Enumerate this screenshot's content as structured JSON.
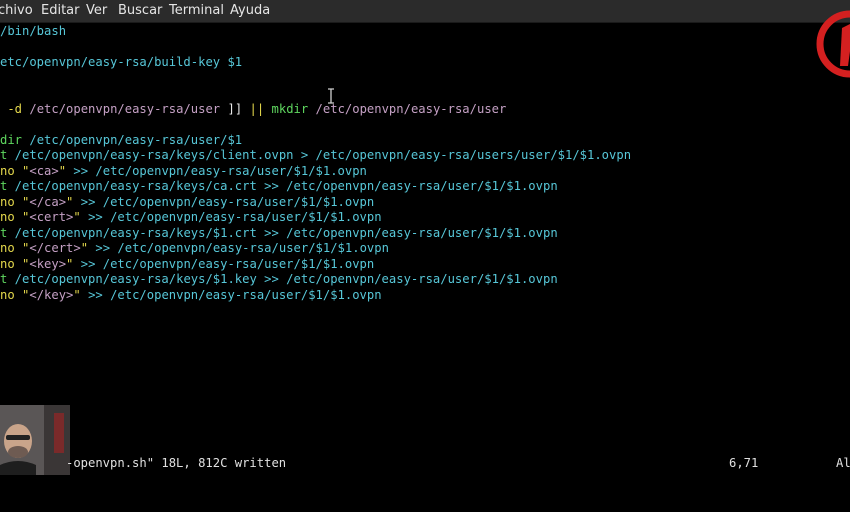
{
  "menu": {
    "items": [
      {
        "label": "chivo"
      },
      {
        "label": "Editar"
      },
      {
        "label": "Ver"
      },
      {
        "label": "Buscar"
      },
      {
        "label": "Terminal"
      },
      {
        "label": "Ayuda"
      }
    ]
  },
  "editor": {
    "lines": [
      {
        "text": "/bin/bash",
        "color": "cyan"
      },
      {
        "text": "",
        "color": "white"
      },
      {
        "text": "etc/openvpn/easy-rsa/build-key $1",
        "color": "cyan"
      },
      {
        "text": "",
        "color": "white"
      },
      {
        "text": "",
        "color": "white"
      },
      {
        "text": " -d /etc/openvpn/easy-rsa/user ]] || mkdir /etc/openvpn/easy-rsa/user",
        "color": "mixed-test"
      },
      {
        "text": "",
        "color": "white"
      },
      {
        "text": "dir /etc/openvpn/easy-rsa/user/$1",
        "color": "mixed-mkdir"
      },
      {
        "text": "t /etc/openvpn/easy-rsa/keys/client.ovpn > /etc/openvpn/easy-rsa/users/user/$1/$1.ovpn",
        "color": "mixed-cat"
      },
      {
        "text": "no \"<ca>\" >> /etc/openvpn/easy-rsa/user/$1/$1.ovpn",
        "color": "mixed-echo"
      },
      {
        "text": "t /etc/openvpn/easy-rsa/keys/ca.crt >> /etc/openvpn/easy-rsa/user/$1/$1.ovpn",
        "color": "mixed-cat"
      },
      {
        "text": "no \"</ca>\" >> /etc/openvpn/easy-rsa/user/$1/$1.ovpn",
        "color": "mixed-echo"
      },
      {
        "text": "no \"<cert>\" >> /etc/openvpn/easy-rsa/user/$1/$1.ovpn",
        "color": "mixed-echo"
      },
      {
        "text": "t /etc/openvpn/easy-rsa/keys/$1.crt >> /etc/openvpn/easy-rsa/user/$1/$1.ovpn",
        "color": "mixed-cat"
      },
      {
        "text": "no \"</cert>\" >> /etc/openvpn/easy-rsa/user/$1/$1.ovpn",
        "color": "mixed-echo"
      },
      {
        "text": "no \"<key>\" >> /etc/openvpn/easy-rsa/user/$1/$1.ovpn",
        "color": "mixed-echo"
      },
      {
        "text": "t /etc/openvpn/easy-rsa/keys/$1.key >> /etc/openvpn/easy-rsa/user/$1/$1.ovpn",
        "color": "mixed-cat"
      },
      {
        "text": "no \"</key>\" >> /etc/openvpn/easy-rsa/user/$1/$1.ovpn",
        "color": "mixed-echo"
      }
    ]
  },
  "status": {
    "message": "-openvpn.sh\" 18L, 812C written",
    "position": "6,71",
    "scroll": "Al"
  },
  "colors": {
    "background": "#000000",
    "menubar": "#2b2b2b",
    "green": "#5fd75f",
    "cyan": "#57c7d8",
    "yellow": "#e4d84c",
    "logo_red": "#d42020"
  }
}
